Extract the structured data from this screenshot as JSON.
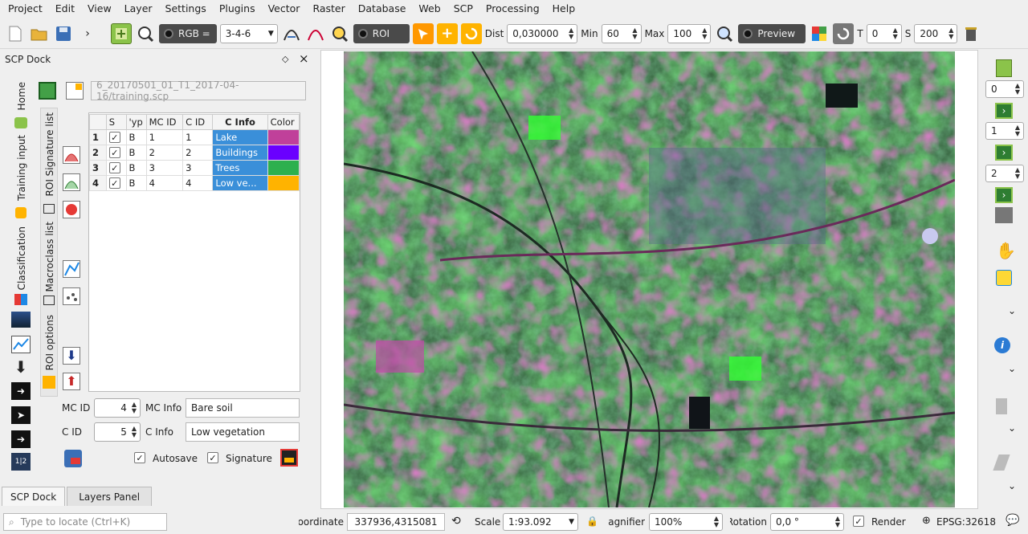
{
  "menu": [
    "Project",
    "Edit",
    "View",
    "Layer",
    "Settings",
    "Plugins",
    "Vector",
    "Raster",
    "Database",
    "Web",
    "SCP",
    "Processing",
    "Help"
  ],
  "toolbar": {
    "rgb_label": "RGB =",
    "rgb_value": "3-4-6",
    "roi_label": "ROI",
    "dist_label": "Dist",
    "dist_value": "0,030000",
    "min_label": "Min",
    "min_value": "60",
    "max_label": "Max",
    "max_value": "100",
    "preview_label": "Preview",
    "t_label": "T",
    "t_value": "0",
    "s_label": "S",
    "s_value": "200"
  },
  "dock": {
    "title": "SCP Dock",
    "float_icon": "◇",
    "close_icon": "×",
    "left_tabs": [
      "Home",
      "Training input",
      "Classification"
    ],
    "inner_tabs": [
      "ROI Signature list",
      "Macroclass list",
      "ROI options"
    ],
    "training_file": "6_20170501_01_T1_2017-04-16/training.scp"
  },
  "table": {
    "headers": [
      "S",
      "Type",
      "MC ID",
      "C ID",
      "C Info",
      "Color"
    ],
    "header_display": [
      "S",
      "'yp",
      "MC ID",
      "C ID",
      "C Info",
      "Color"
    ],
    "rows": [
      {
        "n": "1",
        "type": "B",
        "mc": "1",
        "c": "1",
        "info": "Lake",
        "color": "#c0409a"
      },
      {
        "n": "2",
        "type": "B",
        "mc": "2",
        "c": "2",
        "info": "Buildings",
        "color": "#6a00ff"
      },
      {
        "n": "3",
        "type": "B",
        "mc": "3",
        "c": "3",
        "info": "Trees",
        "color": "#2db04e"
      },
      {
        "n": "4",
        "type": "B",
        "mc": "4",
        "c": "4",
        "info": "Low ve...",
        "color": "#ffb300"
      }
    ]
  },
  "form": {
    "mc_id_label": "MC ID",
    "mc_id_value": "4",
    "mc_info_label": "MC Info",
    "mc_info_value": "Bare soil",
    "c_id_label": "C ID",
    "c_id_value": "5",
    "c_info_label": "C Info",
    "c_info_value": "Low vegetation",
    "autosave_label": "Autosave",
    "signature_label": "Signature"
  },
  "bottom_tabs": [
    "SCP Dock",
    "Layers Panel"
  ],
  "right": {
    "spin1": "0",
    "spin2": "1",
    "spin3": "2"
  },
  "status": {
    "search_placeholder": "Type to locate (Ctrl+K)",
    "coordinate_label": "Coordinate",
    "coordinate_value": "337936,4315081",
    "scale_label": "Scale",
    "scale_value": "1:93.092",
    "magnifier_label": "Magnifier",
    "magnifier_value": "100%",
    "rotation_label": "Rotation",
    "rotation_value": "0,0 °",
    "render_label": "Render",
    "crs": "EPSG:32618"
  }
}
